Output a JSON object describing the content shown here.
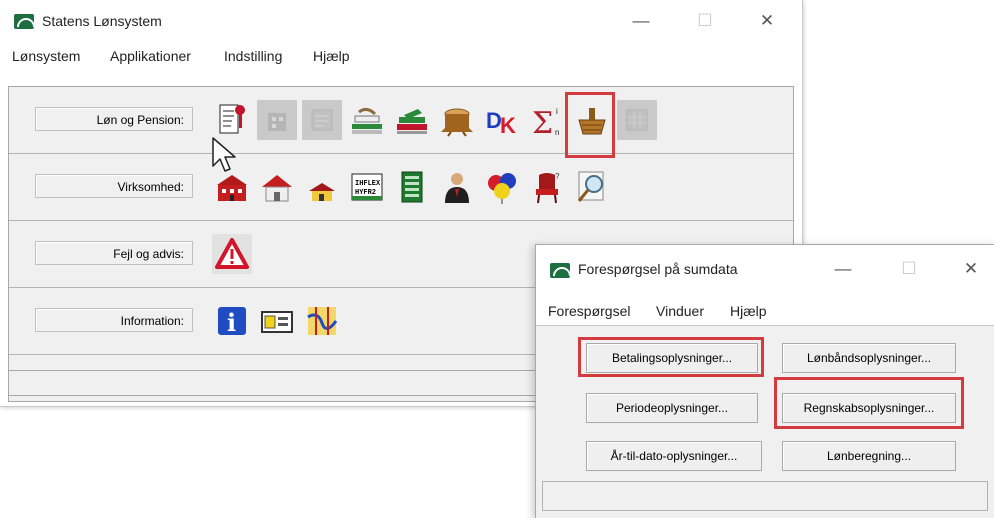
{
  "main_window": {
    "title": "Statens Lønsystem",
    "controls": {
      "minimize": "—",
      "maximize": "☐",
      "close": "✕"
    },
    "menu": [
      "Lønsystem",
      "Applikationer",
      "Indstilling",
      "Hjælp"
    ],
    "rows": [
      {
        "label": "Løn og Pension:",
        "icons": [
          "document-edit-icon",
          "building-grey-icon",
          "form-grey-icon",
          "ruler-hand-icon",
          "book-stack-icon",
          "tree-stump-icon",
          "dk-flag-icon",
          "sigma-sum-icon",
          "basket-icon",
          "grid-grey-icon"
        ]
      },
      {
        "label": "Virksomhed:",
        "icons": [
          "factory-red-icon",
          "house-red-icon",
          "house-small-icon",
          "register-form-icon",
          "card-green-icon",
          "businessman-icon",
          "balloons-icon",
          "chair-icon",
          "magnifier-search-icon"
        ]
      },
      {
        "label": "Fejl og advis:",
        "icons": [
          "warning-triangle-icon"
        ]
      },
      {
        "label": "Information:",
        "icons": [
          "info-icon",
          "id-card-icon",
          "map-icon"
        ]
      }
    ]
  },
  "dialog": {
    "title": "Forespørgsel på sumdata",
    "controls": {
      "minimize": "—",
      "maximize": "☐",
      "close": "✕"
    },
    "menu": [
      "Forespørgsel",
      "Vinduer",
      "Hjælp"
    ],
    "buttons": [
      "Betalingsoplysninger...",
      "Lønbåndsoplysninger...",
      "Periodeoplysninger...",
      "Regnskabsoplysninger...",
      "År-til-dato-oplysninger...",
      "Lønberegning..."
    ]
  },
  "colors": {
    "highlight": "#d33b3f",
    "accent": "#1f6e40"
  }
}
